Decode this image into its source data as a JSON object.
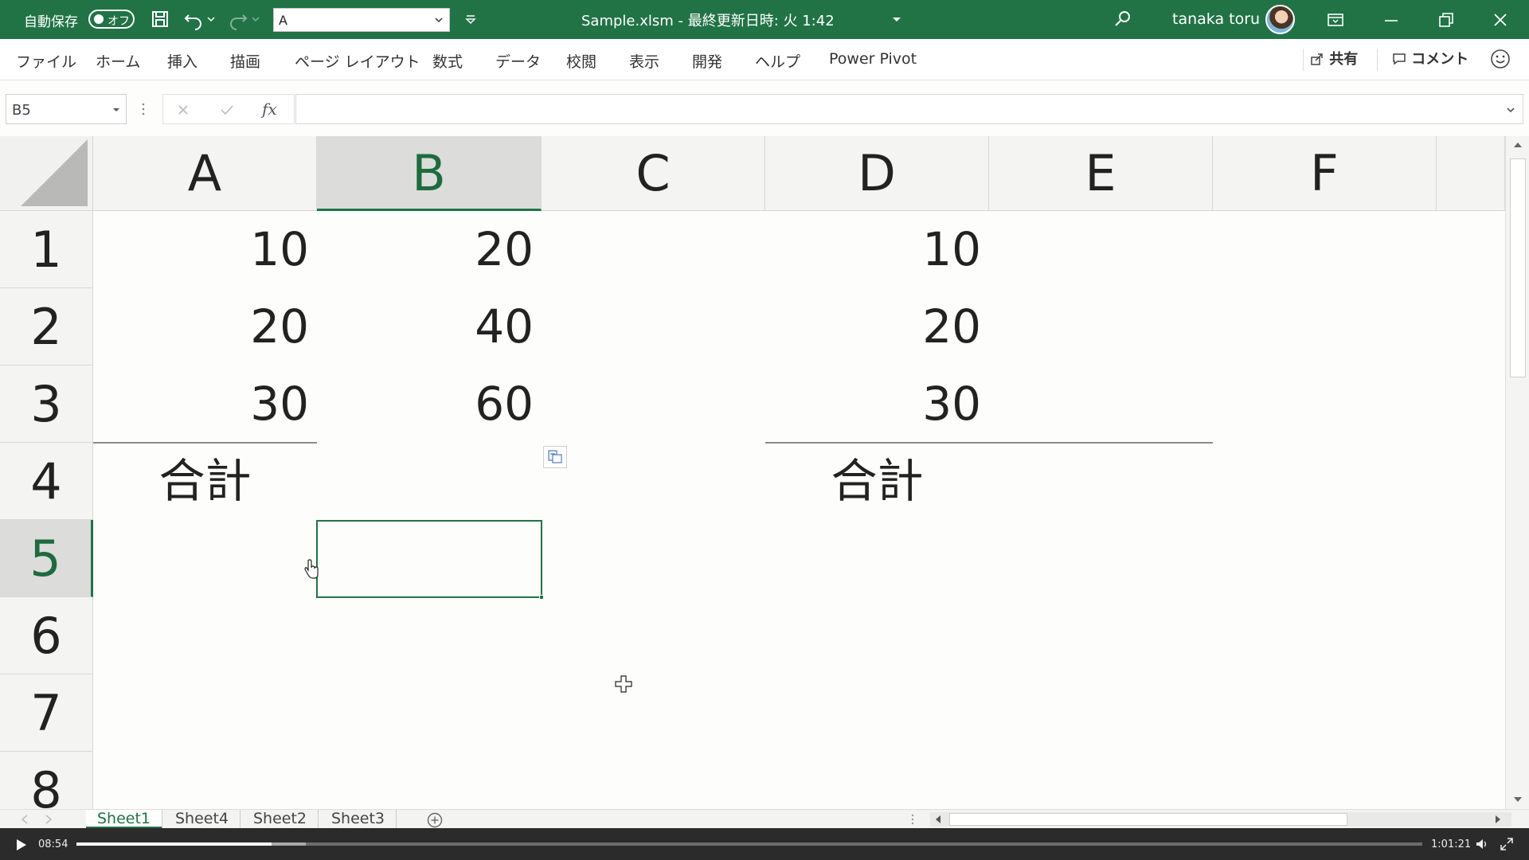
{
  "window": {
    "autosave_label": "自動保存",
    "autosave_state": "オフ",
    "quick_access_value": "A",
    "title": "Sample.xlsm - 最終更新日時: 火 1:42",
    "user_name": "tanaka toru",
    "accent_color": "#217346"
  },
  "ribbon": {
    "tabs": [
      "ファイル",
      "ホーム",
      "挿入",
      "描画",
      "ページ レイアウト",
      "数式",
      "データ",
      "校閲",
      "表示",
      "開発",
      "ヘルプ",
      "Power Pivot"
    ],
    "share_label": "共有",
    "comment_label": "コメント"
  },
  "formula_bar": {
    "name_box": "B5",
    "fx_label": "fx",
    "formula": ""
  },
  "sheet": {
    "columns": [
      "A",
      "B",
      "C",
      "D",
      "E",
      "F"
    ],
    "rows": [
      "1",
      "2",
      "3",
      "4",
      "5",
      "6",
      "7",
      "8"
    ],
    "selected_column": "B",
    "selected_row": "5",
    "cells": {
      "A1": "10",
      "B1": "20",
      "D1": "10",
      "A2": "20",
      "B2": "40",
      "D2": "20",
      "A3": "30",
      "B3": "60",
      "D3": "30",
      "A4": "合計",
      "D4": "合計"
    }
  },
  "sheet_tabs": [
    {
      "label": "Sheet1",
      "active": true
    },
    {
      "label": "Sheet4",
      "active": false
    },
    {
      "label": "Sheet2",
      "active": false
    },
    {
      "label": "Sheet3",
      "active": false
    }
  ],
  "video": {
    "current_time": "08:54",
    "duration": "1:01:21",
    "progress_fraction": 0.145
  }
}
